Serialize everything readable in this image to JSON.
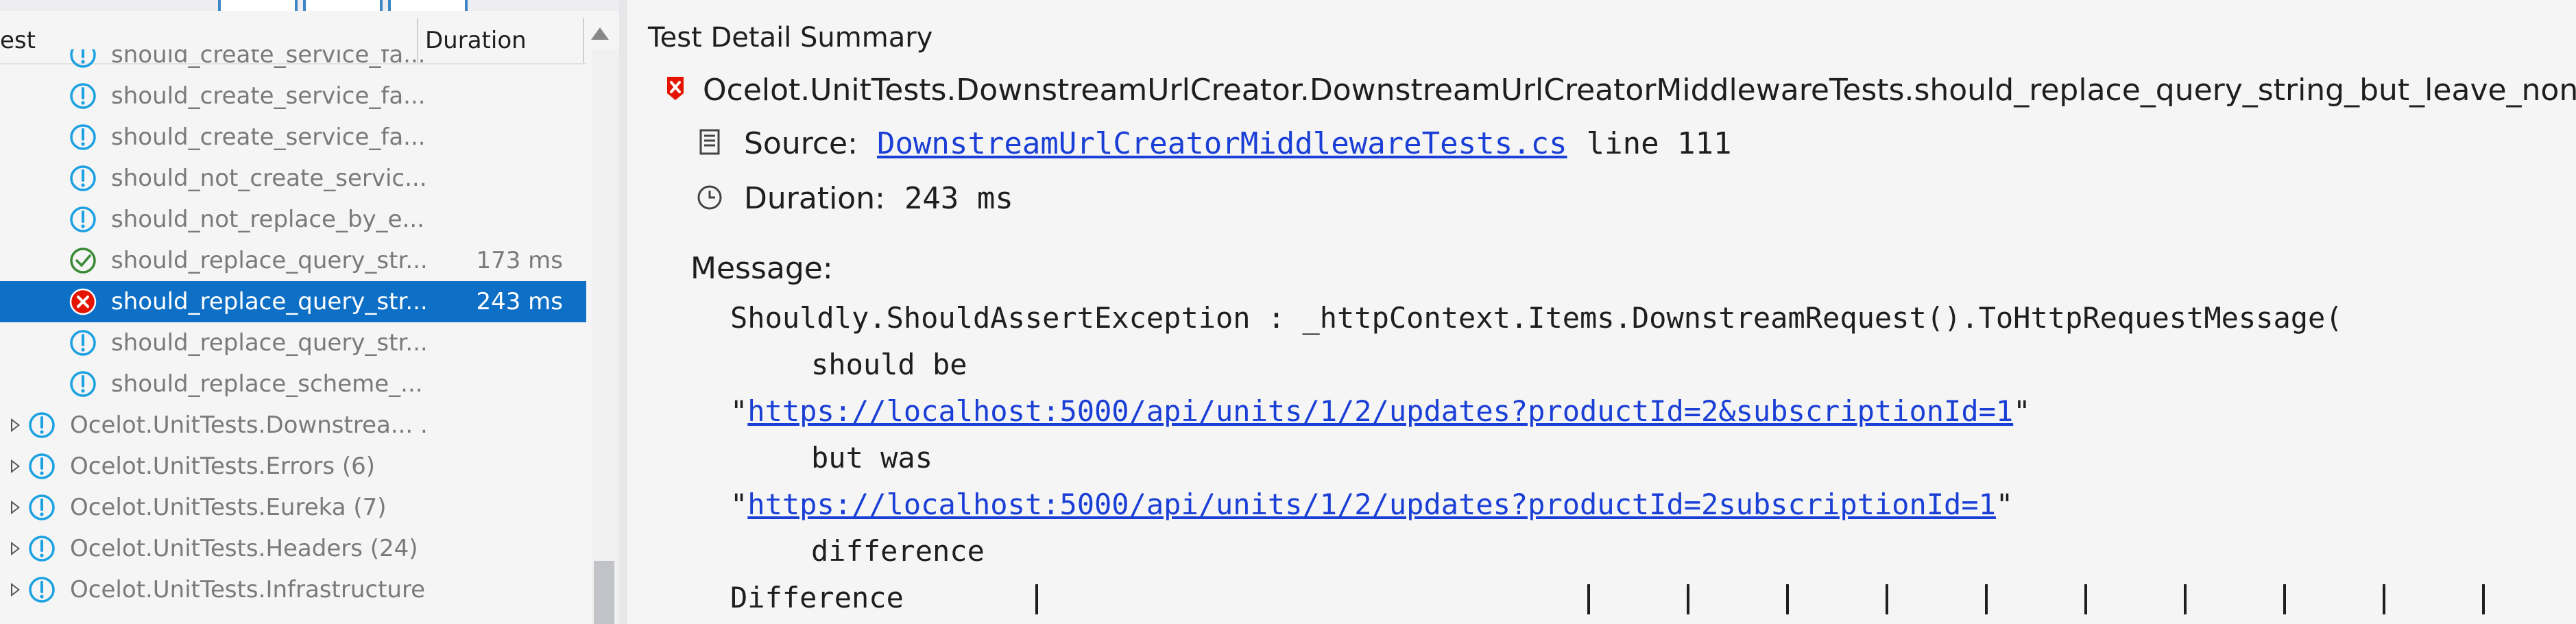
{
  "explorer": {
    "columns": {
      "test": "est",
      "duration": "Duration"
    },
    "rows": [
      {
        "label": "should_create_service_fa...",
        "duration": "",
        "status": "notrun",
        "indent": 1
      },
      {
        "label": "should_create_service_fa...",
        "duration": "",
        "status": "notrun",
        "indent": 1
      },
      {
        "label": "should_create_service_fa...",
        "duration": "",
        "status": "notrun",
        "indent": 1
      },
      {
        "label": "should_not_create_servic...",
        "duration": "",
        "status": "notrun",
        "indent": 1
      },
      {
        "label": "should_not_replace_by_e...",
        "duration": "",
        "status": "notrun",
        "indent": 1
      },
      {
        "label": "should_replace_query_str...",
        "duration": "173 ms",
        "status": "passed",
        "indent": 1
      },
      {
        "label": "should_replace_query_str...",
        "duration": "243 ms",
        "status": "failed",
        "indent": 1,
        "selected": true
      },
      {
        "label": "should_replace_query_str...",
        "duration": "",
        "status": "notrun",
        "indent": 1
      },
      {
        "label": "should_replace_scheme_...",
        "duration": "",
        "status": "notrun",
        "indent": 1
      },
      {
        "label": "Ocelot.UnitTests.Downstrea... .",
        "duration": "",
        "status": "notrun",
        "indent": 0
      },
      {
        "label": "Ocelot.UnitTests.Errors (6)",
        "duration": "",
        "status": "notrun",
        "indent": 0
      },
      {
        "label": "Ocelot.UnitTests.Eureka (7)",
        "duration": "",
        "status": "notrun",
        "indent": 0
      },
      {
        "label": "Ocelot.UnitTests.Headers (24)",
        "duration": "",
        "status": "notrun",
        "indent": 0
      },
      {
        "label": "Ocelot.UnitTests.Infrastructure",
        "duration": "",
        "status": "notrun",
        "indent": 0
      }
    ]
  },
  "detail": {
    "title": "Test Detail Summary",
    "test_full_name": "Ocelot.UnitTests.DownstreamUrlCreator.DownstreamUrlCreatorMiddlewareTests.should_replace_query_string_but_leave_non_plac",
    "source_label": "Source:",
    "source_file": "DownstreamUrlCreatorMiddlewareTests.cs",
    "source_line": "line 111",
    "duration_label": "Duration:",
    "duration_value": "243 ms",
    "message_label": "Message:",
    "message": {
      "exception": "Shouldly.ShouldAssertException : _httpContext.Items.DownstreamRequest().ToHttpRequestMessage(",
      "should_be": "should be",
      "expected_url": "https://localhost:5000/api/units/1/2/updates?productId=2&subscriptionId=1",
      "but_was": "but was",
      "actual_url": "https://localhost:5000/api/units/1/2/updates?productId=2subscriptionId=1",
      "difference": "difference",
      "difference_header": "Difference"
    }
  },
  "colors": {
    "selection": "#0e6fc6",
    "failed": "#e51400",
    "passed": "#388a34",
    "notrun": "#1ba1e2",
    "link": "#1a3fd6"
  }
}
